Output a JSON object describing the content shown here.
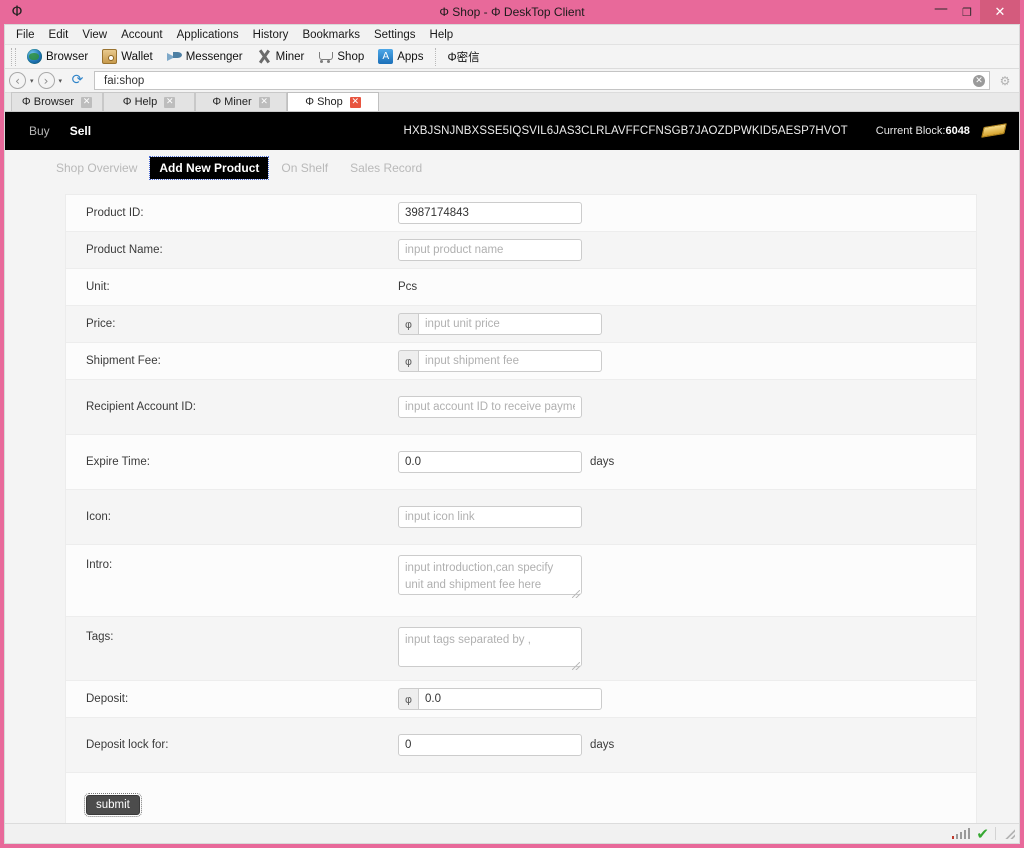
{
  "window": {
    "logo": "Φ",
    "title": "Φ Shop - Φ DeskTop Client",
    "minimize": "—",
    "maximize": "❐",
    "close": "✕"
  },
  "menubar": {
    "items": [
      {
        "label": "File"
      },
      {
        "label": "Edit"
      },
      {
        "label": "View"
      },
      {
        "label": "Account"
      },
      {
        "label": "Applications"
      },
      {
        "label": "History"
      },
      {
        "label": "Bookmarks"
      },
      {
        "label": "Settings"
      },
      {
        "label": "Help"
      }
    ]
  },
  "toolbar": {
    "items": [
      {
        "label": "Browser",
        "icon": "globe-icon"
      },
      {
        "label": "Wallet",
        "icon": "wallet-icon"
      },
      {
        "label": "Messenger",
        "icon": "messenger-icon"
      },
      {
        "label": "Miner",
        "icon": "pickaxe-icon"
      },
      {
        "label": "Shop",
        "icon": "cart-icon"
      },
      {
        "label": "Apps",
        "icon": "apps-icon",
        "glyph": "A"
      }
    ],
    "extra_label": "Φ密信"
  },
  "addressbar": {
    "back": "‹",
    "forward": "›",
    "caret": "▾",
    "reload": "⟳",
    "url": "fai:shop",
    "clear": "✕",
    "gear": "⚙"
  },
  "browser_tabs": [
    {
      "label": "Φ Browser",
      "close": "✕",
      "active": false
    },
    {
      "label": "Φ Help",
      "close": "✕",
      "active": false
    },
    {
      "label": "Φ Miner",
      "close": "✕",
      "active": false
    },
    {
      "label": "Φ Shop",
      "close": "✕",
      "active": true
    }
  ],
  "topnav": {
    "buy": "Buy",
    "sell": "Sell",
    "account_address": "HXBJSNJNBXSSE5IQSVIL6JAS3CLRLAVFFCFNSGB7JAOZDPWKID5AESP7HVOT",
    "block_label": "Current Block:",
    "block_value": "6048"
  },
  "subnav": {
    "tabs": [
      {
        "label": "Shop Overview",
        "active": false
      },
      {
        "label": "Add New Product",
        "active": true
      },
      {
        "label": "On Shelf",
        "active": false
      },
      {
        "label": "Sales Record",
        "active": false
      }
    ]
  },
  "form": {
    "product_id": {
      "label": "Product ID:",
      "value": "3987174843"
    },
    "product_name": {
      "label": "Product Name:",
      "placeholder": "input product name"
    },
    "unit": {
      "label": "Unit:",
      "value": "Pcs"
    },
    "price": {
      "label": "Price:",
      "prefix": "φ",
      "placeholder": "input unit price"
    },
    "shipment_fee": {
      "label": "Shipment Fee:",
      "prefix": "φ",
      "placeholder": "input shipment fee"
    },
    "recipient": {
      "label": "Recipient Account ID:",
      "placeholder": "input account ID to receive payment"
    },
    "expire_time": {
      "label": "Expire Time:",
      "value": "0.0",
      "suffix": "days"
    },
    "icon": {
      "label": "Icon:",
      "placeholder": "input icon link"
    },
    "intro": {
      "label": "Intro:",
      "placeholder": "input introduction,can specify unit and shipment fee here"
    },
    "tags": {
      "label": "Tags:",
      "placeholder": "input tags separated by ,"
    },
    "deposit": {
      "label": "Deposit:",
      "prefix": "φ",
      "value": "0.0"
    },
    "deposit_lock": {
      "label": "Deposit lock for:",
      "value": "0",
      "suffix": "days"
    },
    "submit": "submit"
  },
  "statusbar": {
    "signal": "signal-bars-icon",
    "status": "✔"
  },
  "colors": {
    "accent_pink": "#e8699a",
    "nav_black": "#000000",
    "close_red": "#d45b7d",
    "ok_green": "#36a832"
  }
}
